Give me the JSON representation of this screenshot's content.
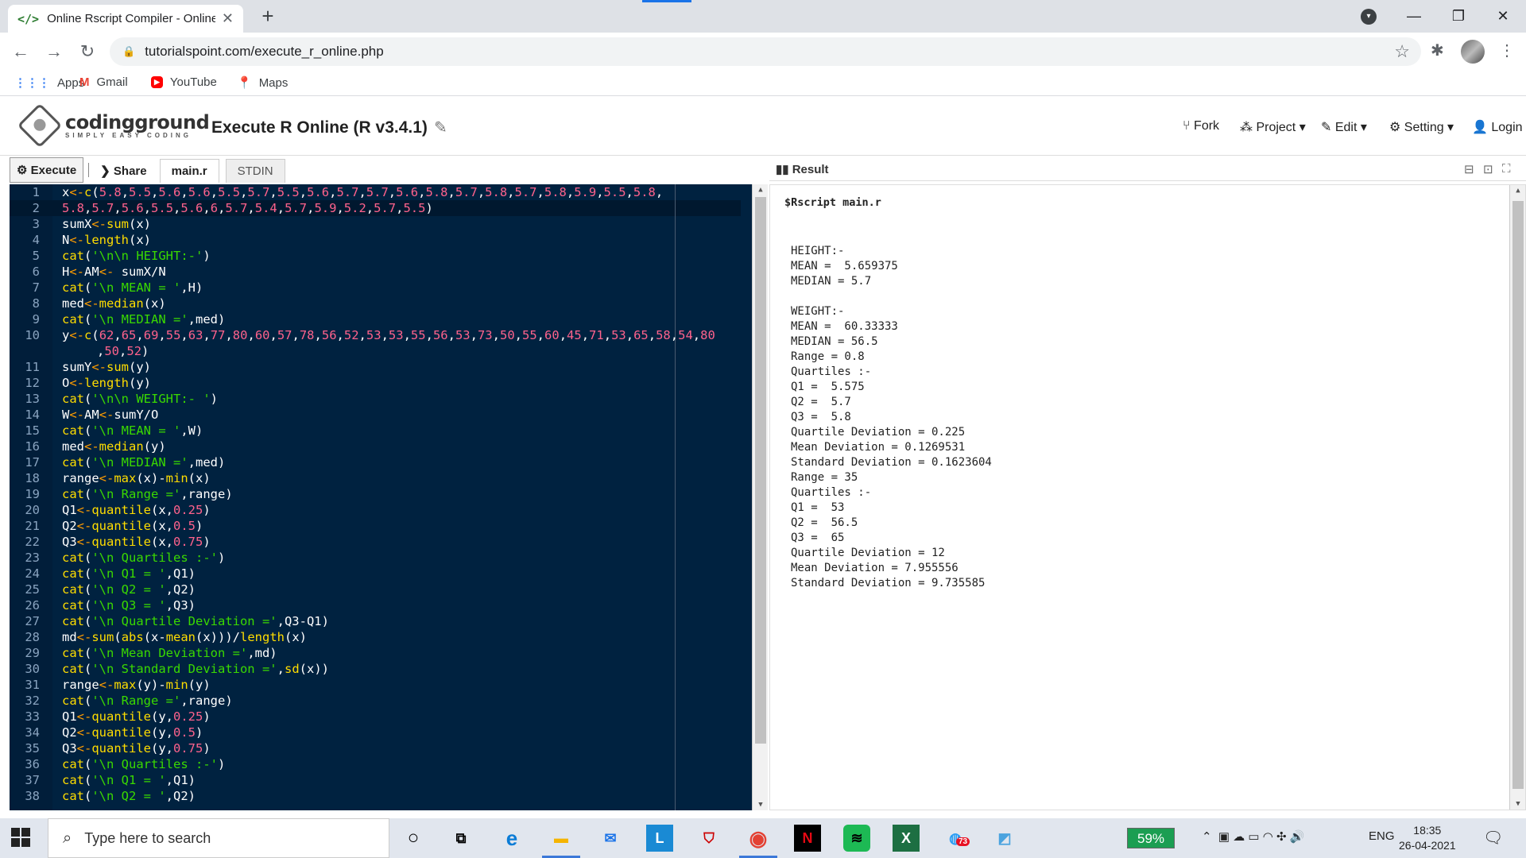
{
  "browser": {
    "tab_title": "Online Rscript Compiler - Online",
    "tab_favicon": "</>",
    "url": "tutorialspoint.com/execute_r_online.php",
    "bookmarks": [
      {
        "label": "Apps",
        "icon": "apps-grid-icon"
      },
      {
        "label": "Gmail",
        "icon": "gmail-icon"
      },
      {
        "label": "YouTube",
        "icon": "youtube-icon"
      },
      {
        "label": "Maps",
        "icon": "maps-icon"
      }
    ]
  },
  "site": {
    "logo_name": "codingground",
    "logo_tagline": "SIMPLY EASY CODING",
    "title": "Execute R Online (R v3.4.1)",
    "menu": {
      "fork": "Fork",
      "project": "Project",
      "edit": "Edit",
      "setting": "Setting",
      "login": "Login"
    }
  },
  "editor": {
    "execute": "Execute",
    "share": "Share",
    "file_tab": "main.r",
    "stdin_tab": "STDIN",
    "lines": [
      {
        "n": "1",
        "html": "x<span class=\"k\">&lt;-</span><span class=\"f\">c</span>(<span class=\"n\">5.8</span>,<span class=\"n\">5.5</span>,<span class=\"n\">5.6</span>,<span class=\"n\">5.6</span>,<span class=\"n\">5.5</span>,<span class=\"n\">5.7</span>,<span class=\"n\">5.5</span>,<span class=\"n\">5.6</span>,<span class=\"n\">5.7</span>,<span class=\"n\">5.7</span>,<span class=\"n\">5.6</span>,<span class=\"n\">5.8</span>,<span class=\"n\">5.7</span>,<span class=\"n\">5.8</span>,<span class=\"n\">5.7</span>,<span class=\"n\">5.8</span>,<span class=\"n\">5.9</span>,<span class=\"n\">5.5</span>,<span class=\"n\">5.8</span>,"
      },
      {
        "n": "2",
        "html": "<span class=\"n\">5.8</span>,<span class=\"n\">5.7</span>,<span class=\"n\">5.6</span>,<span class=\"n\">5.5</span>,<span class=\"n\">5.6</span>,<span class=\"n\">6</span>,<span class=\"n\">5.7</span>,<span class=\"n\">5.4</span>,<span class=\"n\">5.7</span>,<span class=\"n\">5.9</span>,<span class=\"n\">5.2</span>,<span class=\"n\">5.7</span>,<span class=\"n\">5.5</span>)"
      },
      {
        "n": "3",
        "html": "sumX<span class=\"k\">&lt;-</span><span class=\"f\">sum</span>(x)"
      },
      {
        "n": "4",
        "html": "N<span class=\"k\">&lt;-</span><span class=\"f\">length</span>(x)"
      },
      {
        "n": "5",
        "html": "<span class=\"f\">cat</span>(<span class=\"s\">'\\n\\n HEIGHT:-'</span>)"
      },
      {
        "n": "6",
        "html": "H<span class=\"k\">&lt;-</span>AM<span class=\"k\">&lt;-</span> sumX/N"
      },
      {
        "n": "7",
        "html": "<span class=\"f\">cat</span>(<span class=\"s\">'\\n MEAN = '</span>,H)"
      },
      {
        "n": "8",
        "html": "med<span class=\"k\">&lt;-</span><span class=\"f\">median</span>(x)"
      },
      {
        "n": "9",
        "html": "<span class=\"f\">cat</span>(<span class=\"s\">'\\n MEDIAN ='</span>,med)"
      },
      {
        "n": "10",
        "html": "y<span class=\"k\">&lt;-</span><span class=\"f\">c</span>(<span class=\"n\">62</span>,<span class=\"n\">65</span>,<span class=\"n\">69</span>,<span class=\"n\">55</span>,<span class=\"n\">63</span>,<span class=\"n\">77</span>,<span class=\"n\">80</span>,<span class=\"n\">60</span>,<span class=\"n\">57</span>,<span class=\"n\">78</span>,<span class=\"n\">56</span>,<span class=\"n\">52</span>,<span class=\"n\">53</span>,<span class=\"n\">53</span>,<span class=\"n\">55</span>,<span class=\"n\">56</span>,<span class=\"n\">53</span>,<span class=\"n\">73</span>,<span class=\"n\">50</span>,<span class=\"n\">55</span>,<span class=\"n\">60</span>,<span class=\"n\">45</span>,<span class=\"n\">71</span>,<span class=\"n\">53</span>,<span class=\"n\">65</span>,<span class=\"n\">58</span>,<span class=\"n\">54</span>,<span class=\"n\">80</span>"
      },
      {
        "n": "",
        "html": ",<span class=\"n\">50</span>,<span class=\"n\">52</span>)",
        "cont": true
      },
      {
        "n": "11",
        "html": "sumY<span class=\"k\">&lt;-</span><span class=\"f\">sum</span>(y)"
      },
      {
        "n": "12",
        "html": "O<span class=\"k\">&lt;-</span><span class=\"f\">length</span>(y)"
      },
      {
        "n": "13",
        "html": "<span class=\"f\">cat</span>(<span class=\"s\">'\\n\\n WEIGHT:- '</span>)"
      },
      {
        "n": "14",
        "html": "W<span class=\"k\">&lt;-</span>AM<span class=\"k\">&lt;-</span>sumY/O"
      },
      {
        "n": "15",
        "html": "<span class=\"f\">cat</span>(<span class=\"s\">'\\n MEAN = '</span>,W)"
      },
      {
        "n": "16",
        "html": "med<span class=\"k\">&lt;-</span><span class=\"f\">median</span>(y)"
      },
      {
        "n": "17",
        "html": "<span class=\"f\">cat</span>(<span class=\"s\">'\\n MEDIAN ='</span>,med)"
      },
      {
        "n": "18",
        "html": "range<span class=\"k\">&lt;-</span><span class=\"f\">max</span>(x)-<span class=\"f\">min</span>(x)"
      },
      {
        "n": "19",
        "html": "<span class=\"f\">cat</span>(<span class=\"s\">'\\n Range ='</span>,range)"
      },
      {
        "n": "20",
        "html": "Q1<span class=\"k\">&lt;-</span><span class=\"f\">quantile</span>(x,<span class=\"n\">0.25</span>)"
      },
      {
        "n": "21",
        "html": "Q2<span class=\"k\">&lt;-</span><span class=\"f\">quantile</span>(x,<span class=\"n\">0.5</span>)"
      },
      {
        "n": "22",
        "html": "Q3<span class=\"k\">&lt;-</span><span class=\"f\">quantile</span>(x,<span class=\"n\">0.75</span>)"
      },
      {
        "n": "23",
        "html": "<span class=\"f\">cat</span>(<span class=\"s\">'\\n Quartiles :-'</span>)"
      },
      {
        "n": "24",
        "html": "<span class=\"f\">cat</span>(<span class=\"s\">'\\n Q1 = '</span>,Q1)"
      },
      {
        "n": "25",
        "html": "<span class=\"f\">cat</span>(<span class=\"s\">'\\n Q2 = '</span>,Q2)"
      },
      {
        "n": "26",
        "html": "<span class=\"f\">cat</span>(<span class=\"s\">'\\n Q3 = '</span>,Q3)"
      },
      {
        "n": "27",
        "html": "<span class=\"f\">cat</span>(<span class=\"s\">'\\n Quartile Deviation ='</span>,Q3-Q1)"
      },
      {
        "n": "28",
        "html": "md<span class=\"k\">&lt;-</span><span class=\"f\">sum</span>(<span class=\"f\">abs</span>(x-<span class=\"f\">mean</span>(x)))/<span class=\"f\">length</span>(x)"
      },
      {
        "n": "29",
        "html": "<span class=\"f\">cat</span>(<span class=\"s\">'\\n Mean Deviation ='</span>,md)"
      },
      {
        "n": "30",
        "html": "<span class=\"f\">cat</span>(<span class=\"s\">'\\n Standard Deviation ='</span>,<span class=\"f\">sd</span>(x))"
      },
      {
        "n": "31",
        "html": "range<span class=\"k\">&lt;-</span><span class=\"f\">max</span>(y)-<span class=\"f\">min</span>(y)"
      },
      {
        "n": "32",
        "html": "<span class=\"f\">cat</span>(<span class=\"s\">'\\n Range ='</span>,range)"
      },
      {
        "n": "33",
        "html": "Q1<span class=\"k\">&lt;-</span><span class=\"f\">quantile</span>(y,<span class=\"n\">0.25</span>)"
      },
      {
        "n": "34",
        "html": "Q2<span class=\"k\">&lt;-</span><span class=\"f\">quantile</span>(y,<span class=\"n\">0.5</span>)"
      },
      {
        "n": "35",
        "html": "Q3<span class=\"k\">&lt;-</span><span class=\"f\">quantile</span>(y,<span class=\"n\">0.75</span>)"
      },
      {
        "n": "36",
        "html": "<span class=\"f\">cat</span>(<span class=\"s\">'\\n Quartiles :-'</span>)"
      },
      {
        "n": "37",
        "html": "<span class=\"f\">cat</span>(<span class=\"s\">'\\n Q1 = '</span>,Q1)"
      },
      {
        "n": "38",
        "html": "<span class=\"f\">cat</span>(<span class=\"s\">'\\n Q2 = '</span>,Q2)"
      }
    ]
  },
  "result": {
    "label": "Result",
    "command": "$Rscript main.r",
    "output": "HEIGHT:-\nMEAN =  5.659375\nMEDIAN = 5.7\n\nWEIGHT:-\nMEAN =  60.33333\nMEDIAN = 56.5\nRange = 0.8\nQuartiles :-\nQ1 =  5.575\nQ2 =  5.7\nQ3 =  5.8\nQuartile Deviation = 0.225\nMean Deviation = 0.1269531\nStandard Deviation = 0.1623604\nRange = 35\nQuartiles :-\nQ1 =  53\nQ2 =  56.5\nQ3 =  65\nQuartile Deviation = 12\nMean Deviation = 7.955556\nStandard Deviation = 9.735585"
  },
  "taskbar": {
    "search_placeholder": "Type here to search",
    "battery": "59%",
    "language": "ENG",
    "time": "18:35",
    "date": "26-04-2021",
    "badge": "73"
  }
}
